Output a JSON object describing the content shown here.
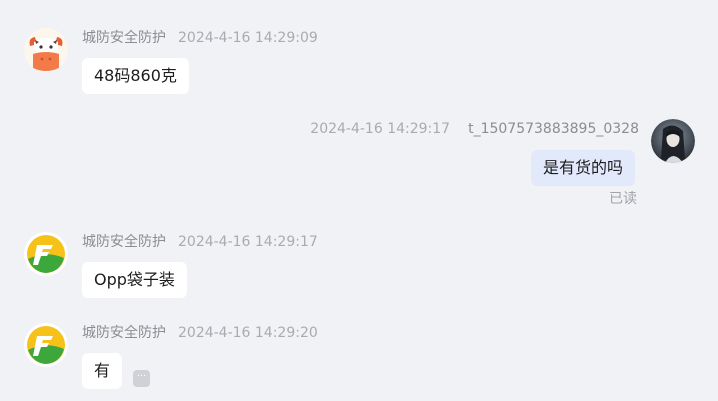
{
  "messages": [
    {
      "sender": "城防安全防护",
      "time": "2024-4-16 14:29:09",
      "text": "48码860克",
      "avatar": "orange-cartoon-cow-avatar"
    },
    {
      "sender": "t_1507573883895_0328",
      "time": "2024-4-16 14:29:17",
      "text": "是有货的吗",
      "status": "已读",
      "avatar": "user-photo-avatar"
    },
    {
      "sender": "城防安全防护",
      "time": "2024-4-16 14:29:17",
      "text": "Opp袋子装",
      "avatar": "green-yellow-logo-avatar"
    },
    {
      "sender": "城防安全防护",
      "time": "2024-4-16 14:29:20",
      "text": "有",
      "avatar": "green-yellow-logo-avatar"
    }
  ],
  "more_icon": "more-options-icon",
  "colors": {
    "background": "#f1f2f6",
    "incoming_bubble": "#ffffff",
    "outgoing_bubble": "#e1e9fb",
    "meta_text": "#a9abb0",
    "logo_yellow": "#f6c21a",
    "logo_green": "#3ca83c",
    "cow_orange": "#f37b4a"
  }
}
